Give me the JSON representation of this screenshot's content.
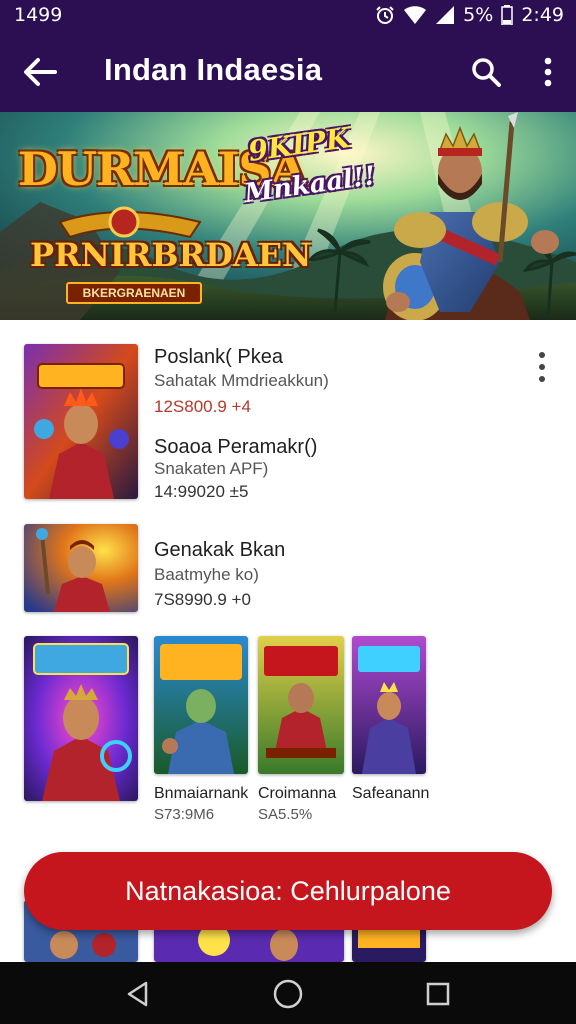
{
  "status_bar": {
    "time_left": "1499",
    "battery_text": "5%",
    "time_right": "2:49",
    "icons": [
      "alarm-icon",
      "wifi-icon",
      "signal-icon",
      "battery-icon"
    ]
  },
  "app_bar": {
    "title": "Indan Indaesia",
    "icons": [
      "back-arrow-icon",
      "search-icon",
      "more-vert-icon"
    ]
  },
  "banner": {
    "logo_title": "DURMAISA",
    "logo_subtitle": "PRNIRBRDAEN",
    "logo_ribbon": "BKERGRAENAEN",
    "tag_line1": "9KIPK",
    "tag_line2": "Mnkaal!!"
  },
  "list": {
    "item1": {
      "title": "Poslank( Pkea",
      "subtitle": "Sahatak Mmdrieakkun)",
      "meta": "12S800.9 +4",
      "title2": "Soaoa Peramakr()",
      "subtitle2": "Snakaten APF)",
      "meta2": "14:99020 ±5"
    },
    "item2": {
      "title": "Genakak Bkan",
      "subtitle": "Baatmyhe ko)",
      "meta": "7S8990.9 +0"
    }
  },
  "cards": [
    {
      "label": "Bnmaiarnank",
      "price": "S73:9M6"
    },
    {
      "label": "Croimanna",
      "price": "SA5.5%"
    },
    {
      "label": "Safeanann",
      "price": ""
    }
  ],
  "cta": {
    "label": "Natnakasioa: Cehlurpalone"
  },
  "colors": {
    "app_bar": "#2c0f52",
    "cta": "#c4161c",
    "meta_red": "#b23a2c",
    "nav_bar": "#0a0a0a"
  }
}
